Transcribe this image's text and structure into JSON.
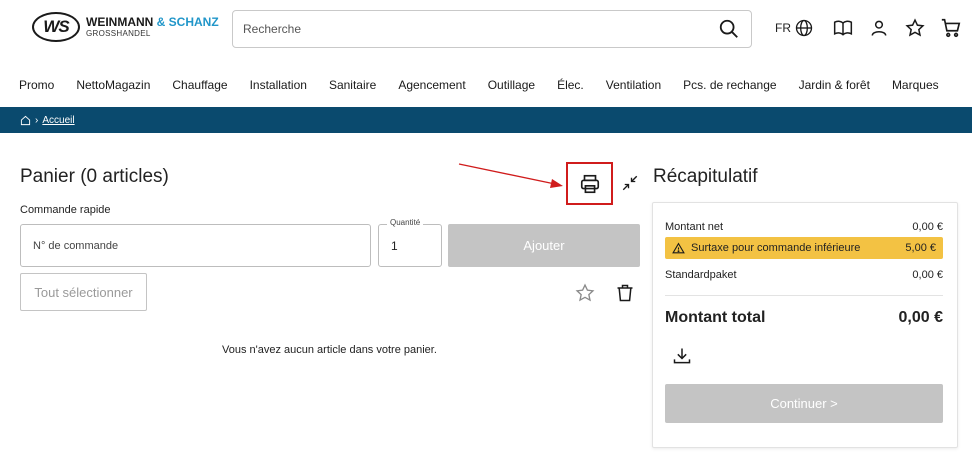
{
  "header": {
    "logo_mark": "WS",
    "logo_name_dark": "WEINMANN",
    "logo_name_blue": "& SCHANZ",
    "logo_sub": "GROSSHANDEL",
    "search_placeholder": "Recherche",
    "language": "FR"
  },
  "nav": {
    "items": [
      "Promo",
      "NettoMagazin",
      "Chauffage",
      "Installation",
      "Sanitaire",
      "Agencement",
      "Outillage",
      "Élec.",
      "Ventilation",
      "Pcs. de rechange",
      "Jardin & forêt",
      "Marques"
    ]
  },
  "breadcrumb": {
    "home": "Accueil"
  },
  "cart": {
    "title": "Panier (0 articles)",
    "quick_order_label": "Commande rapide",
    "order_number_placeholder": "N° de commande",
    "quantity_label": "Quantité",
    "quantity_value": "1",
    "add_label": "Ajouter",
    "select_all_label": "Tout sélectionner",
    "empty_message": "Vous n'avez aucun article dans votre panier."
  },
  "summary": {
    "title": "Récapitulatif",
    "net_label": "Montant net",
    "net_value": "0,00 €",
    "surcharge_label": "Surtaxe pour commande inférieure",
    "surcharge_value": "5,00 €",
    "shipping_label": "Standardpaket",
    "shipping_value": "0,00 €",
    "total_label": "Montant total",
    "total_value": "0,00 €",
    "continue_label": "Continuer >"
  },
  "colors": {
    "brand_blue": "#2196c9",
    "breadcrumb_bg": "#0a4a6e",
    "surcharge_bg": "#f3c243",
    "disabled_button": "#c4c4c4",
    "highlight_red": "#d01c1c"
  }
}
